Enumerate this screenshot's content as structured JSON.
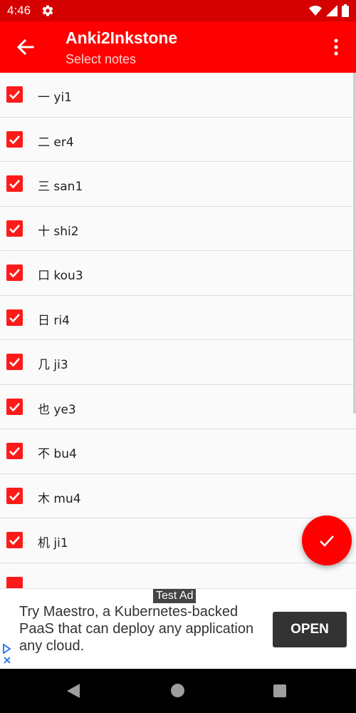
{
  "status_bar": {
    "time": "4:46",
    "icons": [
      "gear-icon",
      "wifi-icon",
      "signal-icon",
      "battery-icon"
    ]
  },
  "app_bar": {
    "title": "Anki2Inkstone",
    "subtitle": "Select notes",
    "icons": [
      "back-arrow-icon",
      "overflow-menu-icon"
    ]
  },
  "notes": [
    {
      "label": "一 yi1",
      "checked": true
    },
    {
      "label": "二 er4",
      "checked": true
    },
    {
      "label": "三 san1",
      "checked": true
    },
    {
      "label": "十 shi2",
      "checked": true
    },
    {
      "label": "口 kou3",
      "checked": true
    },
    {
      "label": "日 ri4",
      "checked": true
    },
    {
      "label": "几 ji3",
      "checked": true
    },
    {
      "label": "也 ye3",
      "checked": true
    },
    {
      "label": "不 bu4",
      "checked": true
    },
    {
      "label": "木 mu4",
      "checked": true
    },
    {
      "label": "机 ji1",
      "checked": true
    }
  ],
  "fab": {
    "icon": "check-icon"
  },
  "ad": {
    "badge": "Test Ad",
    "text": "Try Maestro, a Kubernetes-backed PaaS that can deploy any application any cloud.",
    "button": "OPEN"
  },
  "colors": {
    "status_bar": "#d50000",
    "primary": "#ff0000",
    "ad_button": "#333333"
  }
}
